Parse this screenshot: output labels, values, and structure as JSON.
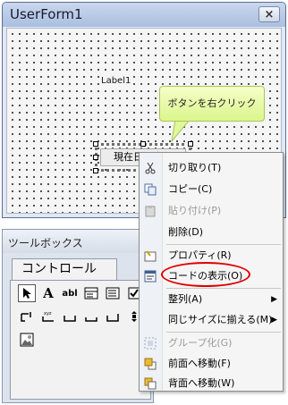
{
  "userform": {
    "title": "UserForm1",
    "close_glyph": "×",
    "label": "Label1",
    "button_caption": "現在日時表示"
  },
  "callout": {
    "text": "ボタンを右クリック"
  },
  "toolbox": {
    "title": "ツールボックス",
    "tab": "コントロール",
    "tools": {
      "pointer": "",
      "label": "A",
      "textbox": "abl"
    }
  },
  "context_menu": {
    "items": [
      {
        "label": "切り取り(T)",
        "icon": "scissors-icon",
        "enabled": true
      },
      {
        "label": "コピー(C)",
        "icon": "copy-icon",
        "enabled": true
      },
      {
        "label": "貼り付け(P)",
        "icon": "paste-icon",
        "enabled": false
      },
      {
        "label": "削除(D)",
        "icon": "",
        "enabled": true
      },
      {
        "label": "プロパティ(R)",
        "icon": "properties-icon",
        "enabled": true
      },
      {
        "label": "コードの表示(O)",
        "icon": "code-window-icon",
        "enabled": true,
        "highlighted": true
      },
      {
        "label": "整列(A)",
        "icon": "",
        "enabled": true,
        "submenu": true
      },
      {
        "label": "同じサイズに揃える(M)",
        "icon": "",
        "enabled": true,
        "submenu": true
      },
      {
        "label": "グループ化(G)",
        "icon": "group-icon",
        "enabled": false
      },
      {
        "label": "前面へ移動(F)",
        "icon": "bring-to-front-icon",
        "enabled": true
      },
      {
        "label": "背面へ移動(W)",
        "icon": "send-to-back-icon",
        "enabled": true
      }
    ],
    "submenu_glyph": "▶"
  },
  "colors": {
    "highlight_circle": "#e00000",
    "callout_fill": "#dcf58c"
  }
}
